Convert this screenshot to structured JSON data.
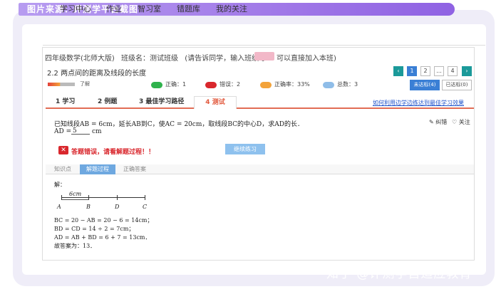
{
  "banner": {
    "text": "图片来源：评测学平台截图"
  },
  "nav": {
    "items": [
      "学习中心",
      "作业",
      "智习室",
      "错题库",
      "我的关注"
    ]
  },
  "course": {
    "title": "四年级数学(北师大版)",
    "class_label": "班级名：测试班级",
    "invite_prefix": "(请告诉同学，输入班级号",
    "invite_suffix": "可以直接加入本班)"
  },
  "lesson": {
    "title": "2.2 两点间的距离及线段的长度"
  },
  "pagination": {
    "pages": [
      "1",
      "2",
      "...",
      "4"
    ],
    "prev": "‹",
    "next": "›"
  },
  "progress": {
    "label": "了解",
    "value_fraction": 0.45
  },
  "stats": [
    {
      "label": "正确：1",
      "color": "#2fb24c"
    },
    {
      "label": "错误：2",
      "color": "#d9272d"
    },
    {
      "label": "正确率：33%",
      "color": "#f3a33a"
    },
    {
      "label": "总数：3",
      "color": "#8fbde8"
    }
  ],
  "status_buttons": {
    "not_reached": "未达标(4)",
    "reached": "已达标(0)"
  },
  "tabs": [
    "1 学习",
    "2 例题",
    "3 最佳学习路径",
    "4 测试"
  ],
  "tab_link": "如何利用边学边练达到最佳学习效果",
  "question": {
    "text": "已知线段AB = 6cm，延长AB到C，使AC = 20cm，取线段BC的中心D，求AD的长．",
    "answer_prefix": "AD =",
    "answer_value": "5",
    "answer_unit": "cm"
  },
  "actions": {
    "correct": "纠错",
    "follow": "关注"
  },
  "feedback": {
    "error_icon": "✕",
    "error_text": "答题错误，请看解题过程！！",
    "continue": "继续练习"
  },
  "subtabs": [
    "知识点",
    "解题过程",
    "正确答案"
  ],
  "solution": {
    "heading": "解：",
    "figure_label": "6cm",
    "points": [
      "A",
      "B",
      "D",
      "C"
    ],
    "lines": [
      "BC = 20 − AB = 20 − 6 = 14cm；",
      "BD = CD = 14 ÷ 2 = 7cm；",
      "AD = AB + BD = 6 + 7 = 13cm．",
      "故答案为：13．"
    ]
  },
  "watermark": "知乎 @评测学自适应教育"
}
